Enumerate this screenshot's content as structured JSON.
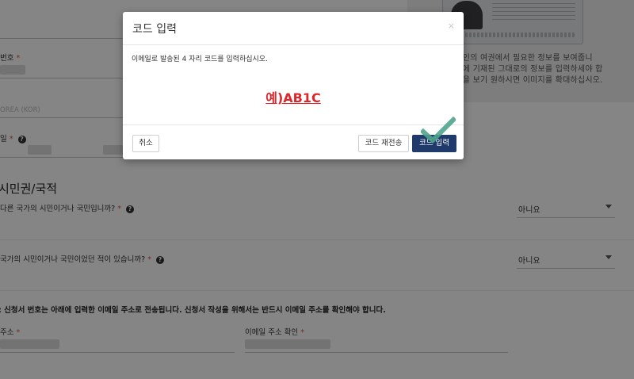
{
  "help": {
    "text": "신청인의 여권에서 필요한 정보를 보여줍니다. 여권에 기재된 그대로의 정보를 입력하세요. 샘플을 보기 원하시면 이미지를 확대하십시오.",
    "text_lines": [
      "신청인의 여권에서 필요한 정보를 보여줍니",
      "여권에 기재된 그대로의 정보를 입력하세야 합",
      "샘플을 보기 원하시면 이미지를 확대하십시오."
    ]
  },
  "form": {
    "number_label": "번호",
    "country_value": "OREA (KOR)",
    "date_label": "일",
    "section_title": "시민권/국적",
    "q1": {
      "label": "다른 국가의 시민이거나 국민입니까?",
      "value": "아니요"
    },
    "q2": {
      "label": "국가의 시민이거나 국민이었던 적이 있습니까?",
      "value": "아니요"
    },
    "notice": ": 신청서 번호는 아래에 입력한 이메일 주소로 전송됩니다. 신청서 작성을 위해서는 반드시 이메일 주소를 확인해야 합니다.",
    "email_label": "주소",
    "email_confirm_label": "이메일 주소 확인",
    "required_mark": "*",
    "help_glyph": "?"
  },
  "modal": {
    "title": "코드 입력",
    "close": "×",
    "instruction": "이메일로 발송된 4 자리 코드를 입력하십시오.",
    "example": "예)AB1C",
    "cancel": "취소",
    "resend": "코드 재전송",
    "submit": "코드 입력"
  },
  "colors": {
    "accent": "#1f3a6b",
    "example": "#e0262b",
    "check": "#4fa58c"
  },
  "icons": {
    "check": "checkmark-icon",
    "help": "question-circle-icon",
    "close": "close-icon"
  }
}
